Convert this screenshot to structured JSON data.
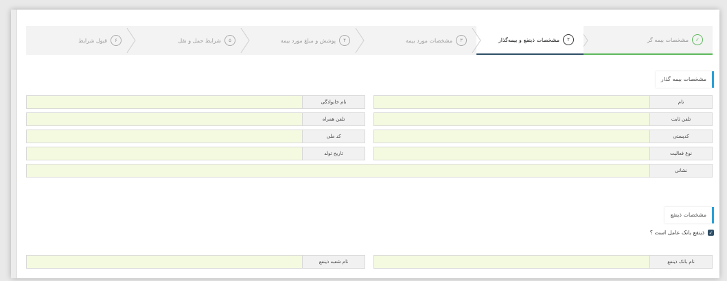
{
  "steps": [
    {
      "number": "✓",
      "label": "مشخصات بیمه گر",
      "state": "done"
    },
    {
      "number": "۲",
      "label": "مشخصات ذینفع و بیمه‌گذار",
      "state": "active"
    },
    {
      "number": "۳",
      "label": "مشخصات مورد بیمه",
      "state": "pending"
    },
    {
      "number": "۴",
      "label": "پوشش و مبلغ مورد بیمه",
      "state": "pending"
    },
    {
      "number": "۵",
      "label": "شرایط حمل و نقل",
      "state": "pending"
    },
    {
      "number": "۶",
      "label": "قبول شرایط",
      "state": "pending"
    }
  ],
  "insured_section": {
    "title": "مشخصات بیمه گذار",
    "fields": {
      "name": {
        "label": "نام",
        "value": ""
      },
      "family": {
        "label": "نام خانوادگی",
        "value": ""
      },
      "landline": {
        "label": "تلفن ثابت",
        "value": ""
      },
      "mobile": {
        "label": "تلفن همراه",
        "value": ""
      },
      "postal_code": {
        "label": "کدپستی",
        "value": ""
      },
      "national_code": {
        "label": "کد ملی",
        "value": ""
      },
      "activity_type": {
        "label": "نوع فعالیت",
        "value": ""
      },
      "birth_date": {
        "label": "تاریخ تولد",
        "value": ""
      },
      "address": {
        "label": "نشانی",
        "value": ""
      }
    }
  },
  "beneficiary_section": {
    "title": "مشخصات ذینفع",
    "checkbox_label": "ذینفع بانک عامل است ؟",
    "checkbox_checked": true,
    "fields": {
      "bank_name": {
        "label": "نام بانک ذینفع",
        "value": ""
      },
      "branch_name": {
        "label": "نام شعبه ذینفع",
        "value": ""
      }
    }
  },
  "colors": {
    "active_step_underline": "#2e4e66",
    "done_step_underline": "#5cb85c",
    "section_accent": "#2a9fd6",
    "input_bg": "#f4fadf"
  }
}
